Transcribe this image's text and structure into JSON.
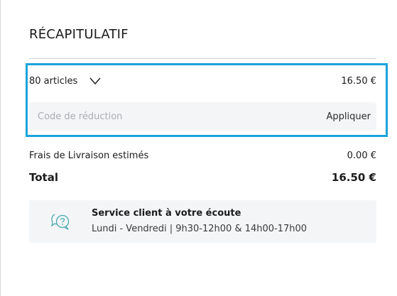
{
  "summary": {
    "title": "RÉCAPITULATIF",
    "articles_label": "80 articles",
    "articles_price": "16.50 €",
    "promo_placeholder": "Code de réduction",
    "apply_label": "Appliquer",
    "shipping_label": "Frais de Livraison estimés",
    "shipping_value": "0.00 €",
    "total_label": "Total",
    "total_value": "16.50 €"
  },
  "service": {
    "title": "Service client à votre écoute",
    "hours": "Lundi - Vendredi | 9h30-12h00 & 14h00-17h00",
    "icon": "chat-help-icon"
  },
  "colors": {
    "highlight": "#1aa3dc",
    "icon_teal": "#4aa9b0",
    "panel_bg": "#f3f5f7"
  }
}
